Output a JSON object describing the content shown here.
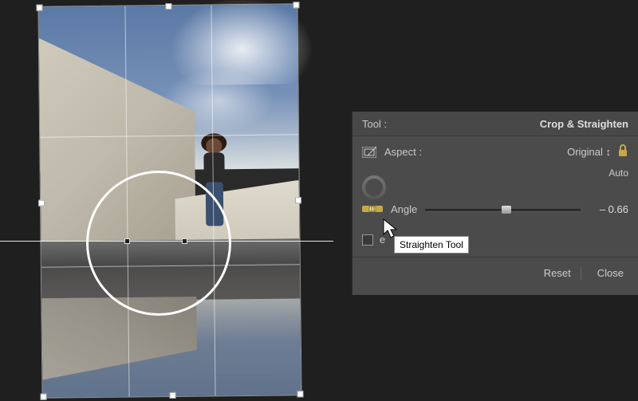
{
  "panel": {
    "tool_label": "Tool :",
    "tool_name": "Crop & Straighten",
    "aspect_label": "Aspect :",
    "aspect_value": "Original",
    "auto_label": "Auto",
    "angle_label": "Angle",
    "angle_value": "– 0.66",
    "constrain_label": "e",
    "reset_label": "Reset",
    "close_label": "Close"
  },
  "tooltip": "Straighten Tool",
  "icons": {
    "aspect": "crop-aspect-icon",
    "lock": "lock-icon",
    "dial": "angle-dial-icon",
    "level": "straighten-level-icon",
    "dropdown": "dropdown-arrows-icon"
  }
}
